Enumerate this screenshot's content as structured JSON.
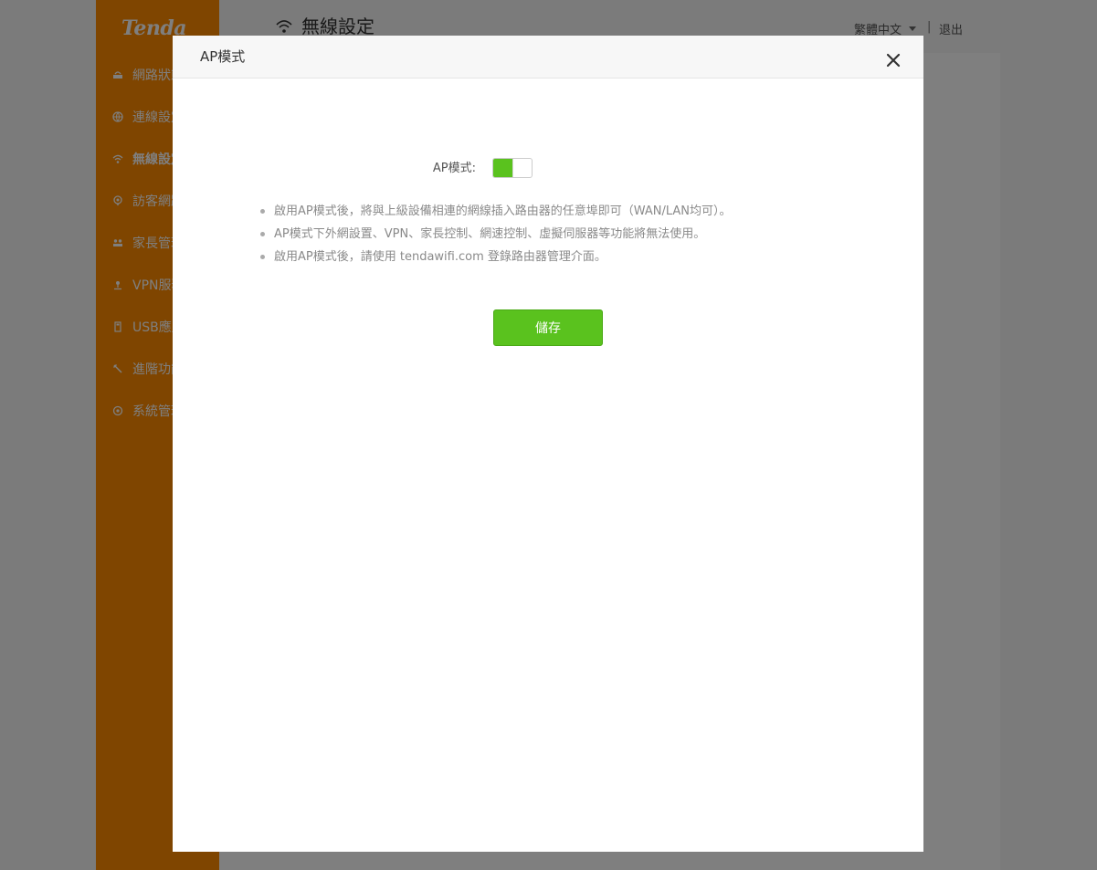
{
  "app": {
    "logo_text": "Tenda",
    "header_title": "無線設定",
    "language": "繁體中文",
    "divider": "|",
    "logout": "退出"
  },
  "sidebar": {
    "items": [
      {
        "label": "網路狀態",
        "icon": "router-icon"
      },
      {
        "label": "連線設定",
        "icon": "globe-icon"
      },
      {
        "label": "無線設定",
        "icon": "wifi-icon",
        "active": true
      },
      {
        "label": "訪客網路",
        "icon": "location-icon"
      },
      {
        "label": "家長管理",
        "icon": "family-icon"
      },
      {
        "label": "VPN服務",
        "icon": "vpn-icon"
      },
      {
        "label": "USB應用",
        "icon": "usb-icon"
      },
      {
        "label": "進階功能",
        "icon": "tools-icon"
      },
      {
        "label": "系統管理",
        "icon": "gear-icon"
      }
    ]
  },
  "modal": {
    "title": "AP模式",
    "switch_label": "AP模式:",
    "switch_on": true,
    "notes": [
      "啟用AP模式後，將與上級設備相連的網線插入路由器的任意埠即可（WAN/LAN均可）。",
      "AP模式下外網設置、VPN、家長控制、網速控制、虛擬伺服器等功能將無法使用。",
      "啟用AP模式後，請使用 tendawifi.com 登錄路由器管理介面。"
    ],
    "save_label": "儲存"
  },
  "colors": {
    "brand_orange": "#ff8a00",
    "accent_green": "#5ac21e",
    "overlay": "rgba(0,0,0,0.5)"
  }
}
